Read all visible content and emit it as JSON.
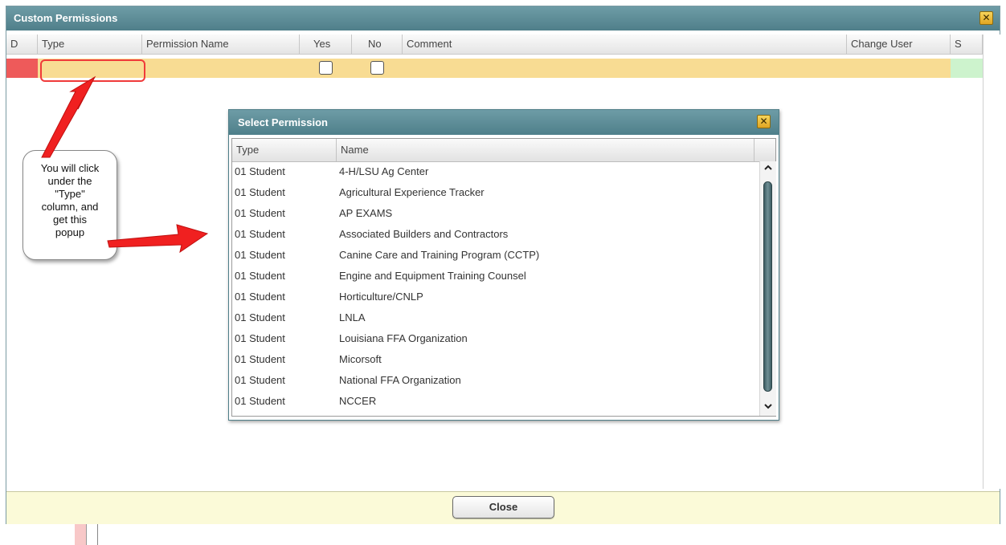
{
  "window": {
    "title": "Custom Permissions"
  },
  "grid": {
    "columns": [
      "D",
      "Type",
      "Permission Name",
      "Yes",
      "No",
      "Comment",
      "Change User",
      "S"
    ]
  },
  "footer": {
    "close_label": "Close"
  },
  "popup": {
    "title": "Select Permission",
    "columns": [
      "Type",
      "Name"
    ],
    "rows": [
      {
        "type": "01 Student",
        "name": "4-H/LSU Ag Center"
      },
      {
        "type": "01 Student",
        "name": "Agricultural Experience Tracker"
      },
      {
        "type": "01 Student",
        "name": "AP EXAMS"
      },
      {
        "type": "01 Student",
        "name": "Associated Builders and Contractors"
      },
      {
        "type": "01 Student",
        "name": "Canine Care and Training Program (CCTP)"
      },
      {
        "type": "01 Student",
        "name": "Engine and Equipment Training Counsel"
      },
      {
        "type": "01 Student",
        "name": "Horticulture/CNLP"
      },
      {
        "type": "01 Student",
        "name": "LNLA"
      },
      {
        "type": "01 Student",
        "name": "Louisiana FFA Organization"
      },
      {
        "type": "01 Student",
        "name": "Micorsoft"
      },
      {
        "type": "01 Student",
        "name": "National FFA Organization"
      },
      {
        "type": "01 Student",
        "name": "NCCER"
      }
    ]
  },
  "annotation": {
    "lines": [
      "You will click",
      "under the",
      "\"Type\"",
      "column, and",
      "get this",
      "popup"
    ]
  },
  "icons": {
    "close": "close-icon",
    "scroll_up": "chevron-up-icon",
    "scroll_down": "chevron-down-icon"
  },
  "colors": {
    "titlebar": "#5a8a95",
    "selected_row": "#f8dc93",
    "delete_cell": "#ee5a5a",
    "status_cell": "#cdf3cd",
    "annotation_arrow": "#f02020"
  }
}
